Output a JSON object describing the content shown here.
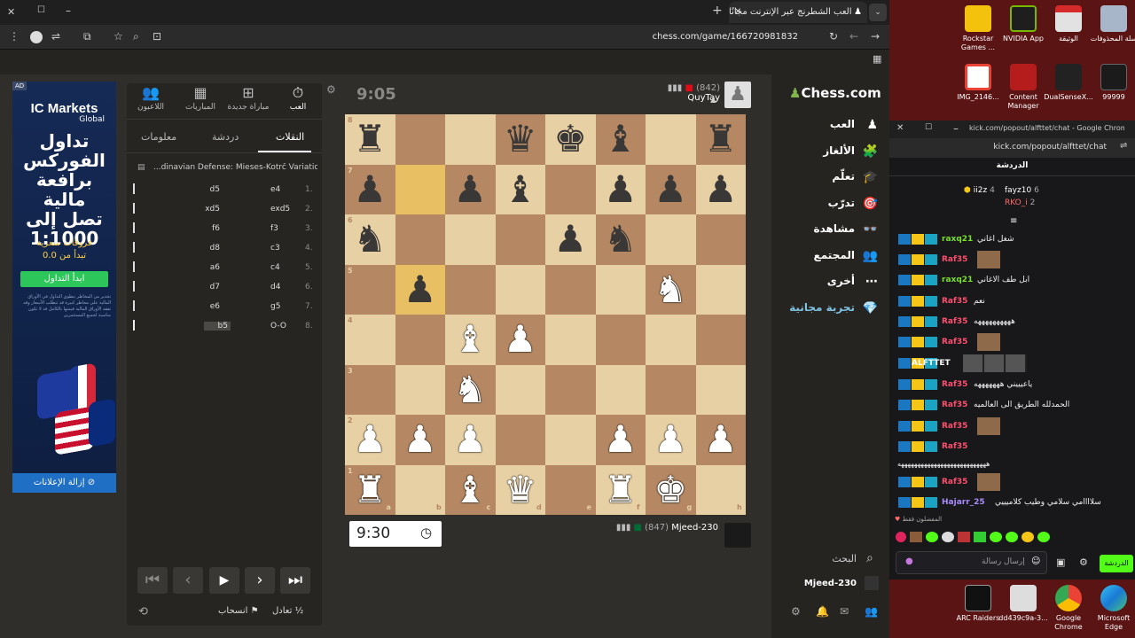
{
  "browser": {
    "tab_title": "العب الشطرنج عبر الإنترنت مجانًا",
    "url": "chess.com/game/166720981832"
  },
  "ad": {
    "badge": "AD",
    "brand": "IC Markets",
    "brand_sub": "Global",
    "headline": [
      "تداول",
      "الفوركس",
      "برافعة مالية",
      "تصل إلى",
      "1:1000"
    ],
    "spreads": "فروقات سعرية",
    "spreads_from": "تبدأ من 0.0",
    "cta": "ابدأ التداول",
    "fine_print": "تحذير من المخاطر يتطوي التداول في الأوراق المالية على مخاطر كبيرة قد تتطلب الأسعار وقد تفقد الأوراق المالية قيمتها بالكامل قد لا تكون مناسبة لجميع المستثمرين",
    "remove": "إزالة الإعلانات"
  },
  "panel": {
    "tabs": [
      "اللاعبون",
      "المباريات",
      "مباراة جديدة",
      "العب"
    ],
    "subtabs": [
      "معلومات",
      "دردشة",
      "النقلات"
    ],
    "opening": "...dinavian Defense: Mieses-Kotrč Variation",
    "moves": [
      {
        "n": "1.",
        "w": "e4",
        "b": "d5"
      },
      {
        "n": "2.",
        "w": "exd5",
        "b": "xd5"
      },
      {
        "n": "3.",
        "w": "f3",
        "b": "f6"
      },
      {
        "n": "4.",
        "w": "c3",
        "b": "d8"
      },
      {
        "n": "5.",
        "w": "c4",
        "b": "a6"
      },
      {
        "n": "6.",
        "w": "d4",
        "b": "d7"
      },
      {
        "n": "7.",
        "w": "g5",
        "b": "e6"
      },
      {
        "n": "8.",
        "w": "O-O",
        "b": "b5"
      }
    ],
    "resign": "انسحاب",
    "draw": "تعادل",
    "half": "½"
  },
  "game": {
    "top_clock": "9:05",
    "top_player": "QuyTay",
    "top_rating": "(842)",
    "bottom_clock": "9:30",
    "bottom_player": "Mjeed-230",
    "bottom_rating": "(847)",
    "files": [
      "a",
      "b",
      "c",
      "d",
      "e",
      "f",
      "g",
      "h"
    ],
    "ranks": [
      "8",
      "7",
      "6",
      "5",
      "4",
      "3",
      "2",
      "1"
    ],
    "position": [
      [
        "r",
        "",
        "",
        "q",
        "k",
        "b",
        "",
        "r"
      ],
      [
        "p",
        "",
        "p",
        "b",
        "",
        "p",
        "p",
        "p"
      ],
      [
        "n",
        "",
        "",
        "",
        "p",
        "n",
        "",
        ""
      ],
      [
        "",
        "p",
        "",
        "",
        "",
        "",
        "N",
        ""
      ],
      [
        "",
        "",
        "B",
        "P",
        "",
        "",
        "",
        ""
      ],
      [
        "",
        "",
        "N",
        "",
        "",
        "",
        "",
        ""
      ],
      [
        "P",
        "P",
        "P",
        "",
        "",
        "P",
        "P",
        "P"
      ],
      [
        "R",
        "",
        "B",
        "Q",
        "",
        "R",
        "K",
        ""
      ]
    ],
    "highlight": [
      "b7",
      "b5"
    ]
  },
  "chessnav": {
    "logo": "Chess.com",
    "items": [
      "العب",
      "الألغاز",
      "تعلّم",
      "تدرّب",
      "مشاهدة",
      "المجتمع",
      "أخرى",
      "تجربة مجانية"
    ],
    "search": "البحث",
    "user": "Mjeed-230"
  },
  "chat_window": {
    "title": "kick.com/popout/alfttet/chat - Google Chrome",
    "url": "kick.com/popout/alfttet/chat",
    "header": "الدردشة",
    "leaders": [
      {
        "name": "ii2z",
        "count": "4"
      },
      {
        "name": "fayz10",
        "count": "6"
      },
      {
        "name": "RKO_i",
        "count": "2"
      }
    ],
    "messages": [
      {
        "user": "raxq21",
        "text": "شغل اغاني",
        "color": "#79e02a"
      },
      {
        "user": "Raf35",
        "text": "",
        "color": "#ff4f6e"
      },
      {
        "user": "raxq21",
        "text": "ابل طف الاغاني",
        "color": "#79e02a"
      },
      {
        "user": "Raf35",
        "text": "نعم",
        "color": "#ff4f6e"
      },
      {
        "user": "Raf35",
        "text": "ههههههههههه",
        "color": "#ff4f6e"
      },
      {
        "user": "Raf35",
        "text": "",
        "color": "#ff4f6e"
      },
      {
        "user": "ALFTTET",
        "text": "",
        "color": "#ffffff"
      },
      {
        "user": "Raf35",
        "text": "ياعيييني هههههههه",
        "color": "#ff4f6e"
      },
      {
        "user": "Raf35",
        "text": "الحمدلله الطريق الى العالميه",
        "color": "#ff4f6e"
      },
      {
        "user": "Raf35",
        "text": "",
        "color": "#ff4f6e"
      },
      {
        "user": "Raf35",
        "text": "",
        "color": "#ff4f6e"
      },
      {
        "user": "",
        "text": "هههههههههههههههههههههههههههه",
        "color": "#ff4f6e"
      },
      {
        "user": "Raf35",
        "text": "",
        "color": "#ff4f6e"
      },
      {
        "user": "Hajarr_25",
        "text": "سلاااامي سلامي وطيب كلاميييي",
        "color": "#a78bfa"
      }
    ],
    "emote_label": "المفضلون فقط",
    "send_placeholder": "إرسال رسالة",
    "send_button": "الدردشة"
  },
  "desktop_icons": [
    {
      "label": "Rockstar Games ..."
    },
    {
      "label": "NVIDIA App"
    },
    {
      "label": "الوثيقة"
    },
    {
      "label": "سلة المحذوفات"
    },
    {
      "label": "IMG_2146..."
    },
    {
      "label": "Content Manager"
    },
    {
      "label": "DualSenseX..."
    },
    {
      "label": "99999"
    },
    {
      "label": "ARC Raiders"
    },
    {
      "label": "dd439c9a-3..."
    },
    {
      "label": "Google Chrome"
    },
    {
      "label": "Microsoft Edge"
    }
  ]
}
